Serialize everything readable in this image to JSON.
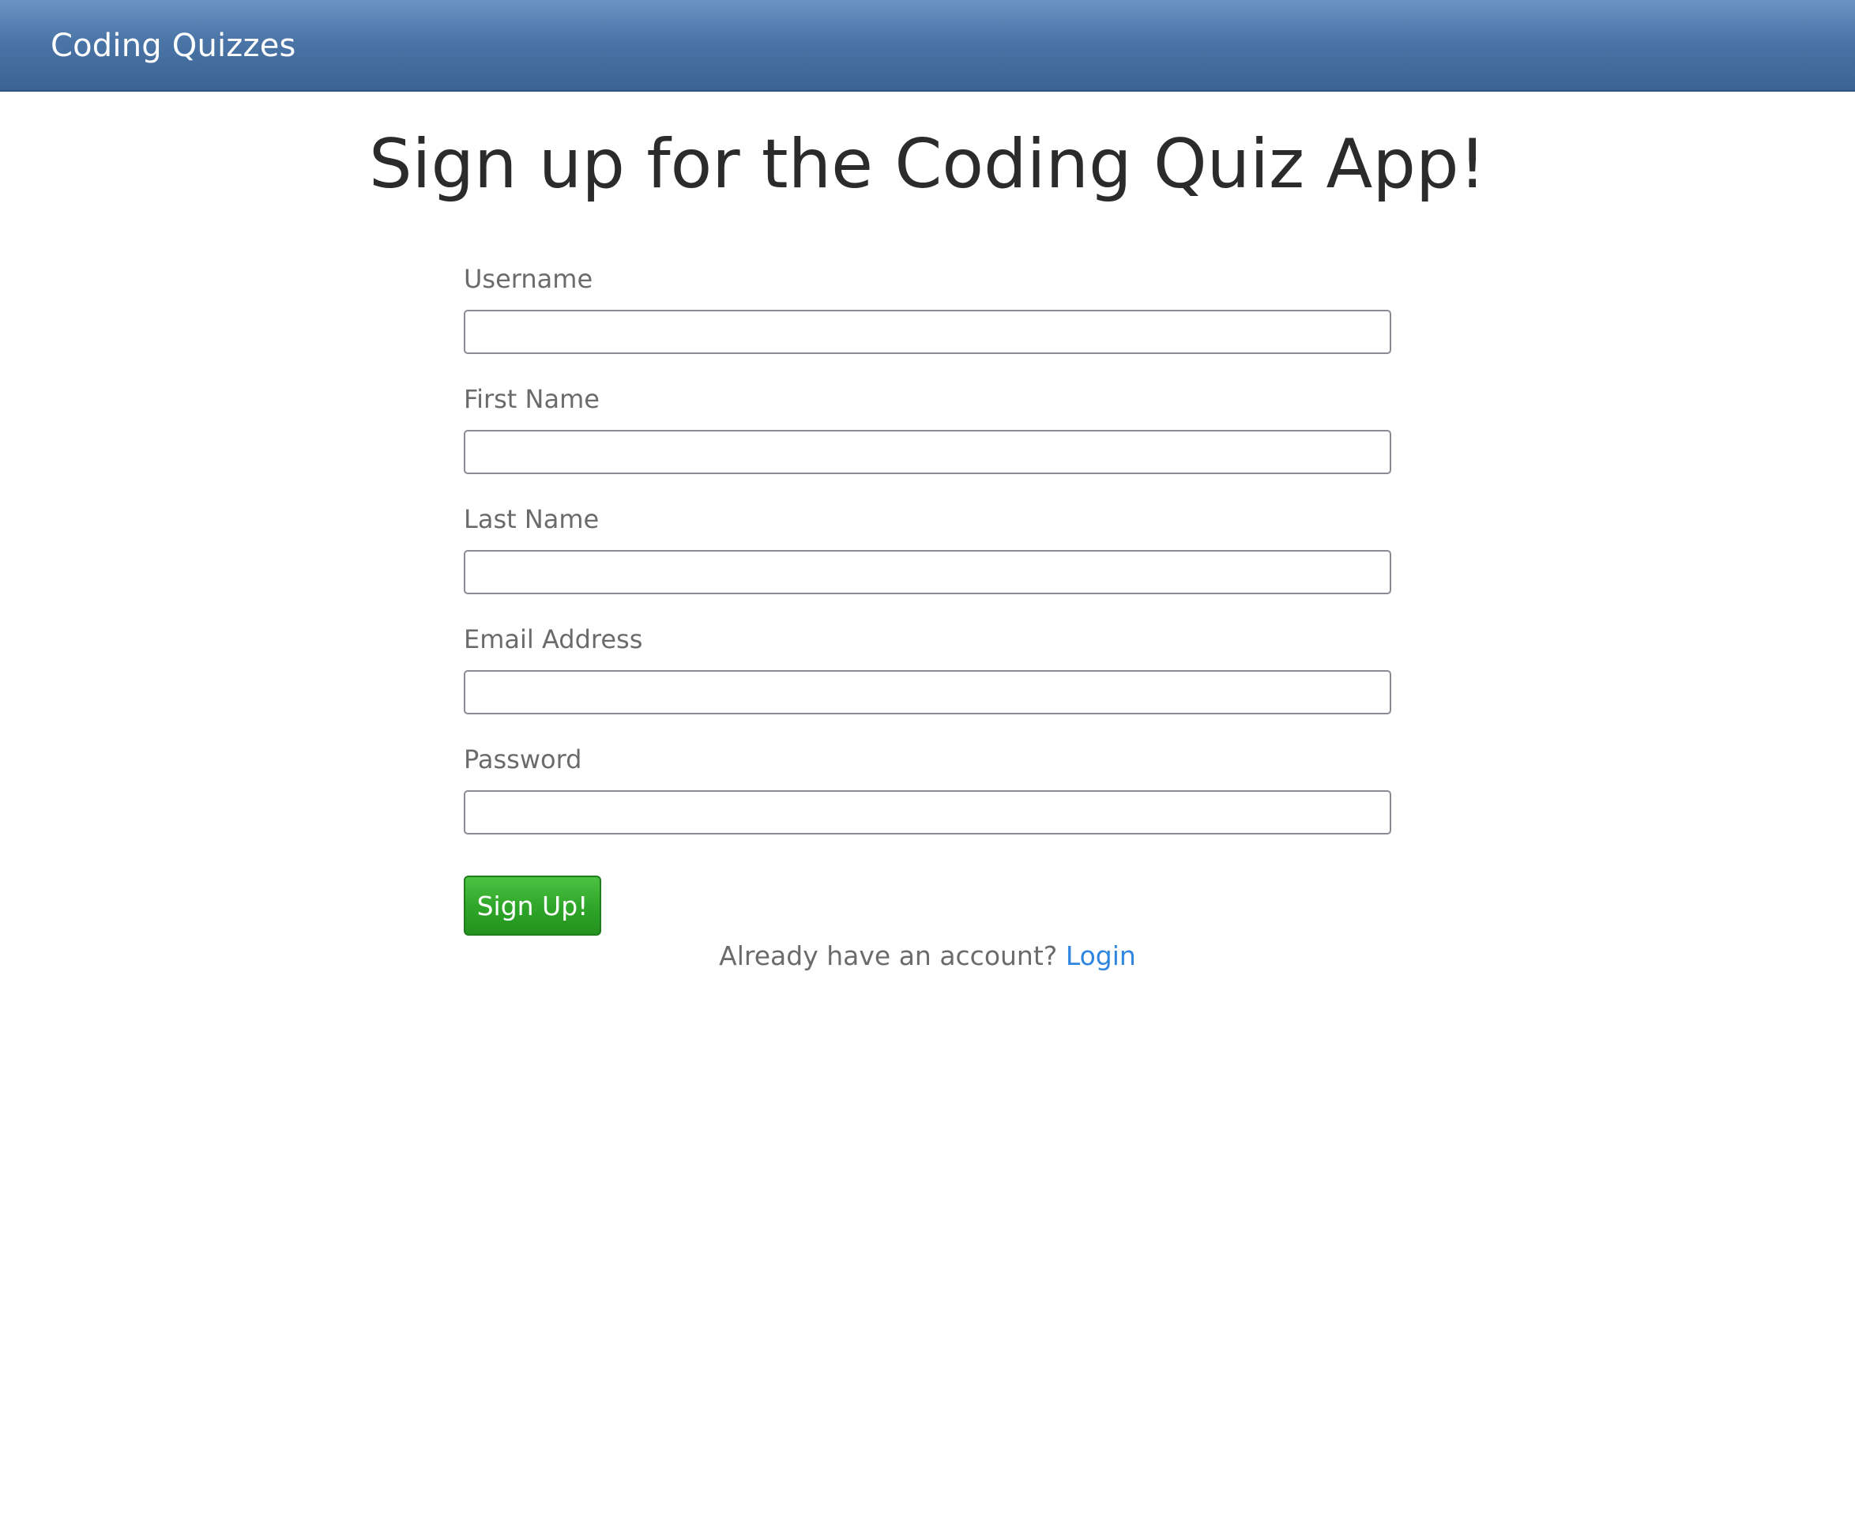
{
  "navbar": {
    "brand": "Coding Quizzes"
  },
  "page": {
    "title": "Sign up for the Coding Quiz App!"
  },
  "form": {
    "fields": [
      {
        "label": "Username",
        "value": ""
      },
      {
        "label": "First Name",
        "value": ""
      },
      {
        "label": "Last Name",
        "value": ""
      },
      {
        "label": "Email Address",
        "value": ""
      },
      {
        "label": "Password",
        "value": ""
      }
    ],
    "submit_label": "Sign Up!"
  },
  "footer": {
    "prompt": "Already have an account?",
    "login_label": "Login"
  },
  "colors": {
    "navbar": "#4a75a6",
    "button": "#2ea528",
    "link": "#2f86de"
  }
}
